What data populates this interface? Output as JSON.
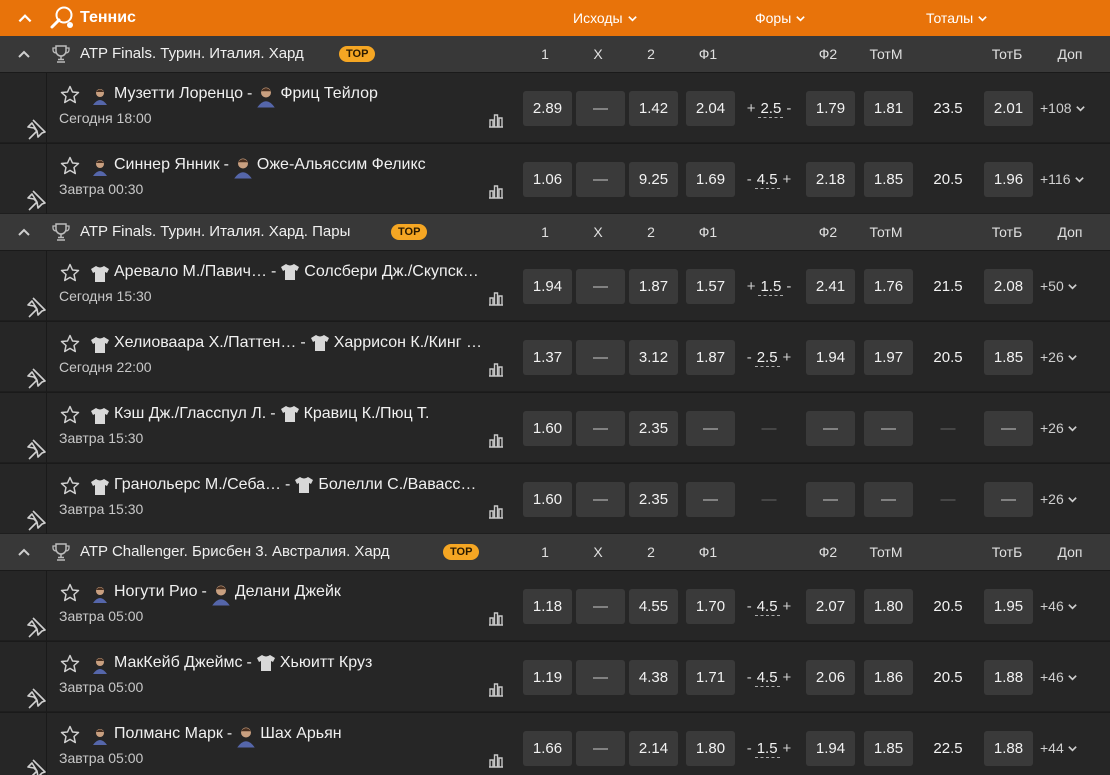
{
  "sport": {
    "title": "Теннис",
    "dropdowns": [
      "Исходы",
      "Форы",
      "Тоталы"
    ]
  },
  "columns": [
    "1",
    "X",
    "2",
    "Ф1",
    "Ф2",
    "ТотМ",
    "ТотБ",
    "Доп"
  ],
  "top_badge": "TOP",
  "leagues": [
    {
      "name": "ATP Finals. Турин. Италия. Хард",
      "matches": [
        {
          "p1": "Музетти Лоренцо",
          "p2": "Фриц Тейлор",
          "time": "Сегодня 18:00",
          "odds": {
            "w1": "2.89",
            "x": "—",
            "w2": "1.42",
            "f1": "2.04",
            "hcap": "2.5",
            "hcap_left": "+",
            "hcap_right": "-",
            "f2": "1.79",
            "totm": "1.81",
            "total": "23.5",
            "totb": "2.01"
          },
          "more": "+108"
        },
        {
          "p1": "Синнер Янник",
          "p2": "Оже-Альяссим Феликс",
          "time": "Завтра 00:30",
          "odds": {
            "w1": "1.06",
            "x": "—",
            "w2": "9.25",
            "f1": "1.69",
            "hcap": "4.5",
            "hcap_left": "-",
            "hcap_right": "+",
            "f2": "2.18",
            "totm": "1.85",
            "total": "20.5",
            "totb": "1.96"
          },
          "more": "+116"
        }
      ]
    },
    {
      "name": "ATP Finals. Турин. Италия. Хард. Пары",
      "matches": [
        {
          "p1": "Аревало М./Павич…",
          "p2": "Солсбери Дж./Скупск…",
          "time": "Сегодня 15:30",
          "odds": {
            "w1": "1.94",
            "x": "—",
            "w2": "1.87",
            "f1": "1.57",
            "hcap": "1.5",
            "hcap_left": "+",
            "hcap_right": "-",
            "f2": "2.41",
            "totm": "1.76",
            "total": "21.5",
            "totb": "2.08"
          },
          "more": "+50"
        },
        {
          "p1": "Хелиоваара Х./Паттен…",
          "p2": "Харрисон К./Кинг …",
          "time": "Сегодня 22:00",
          "odds": {
            "w1": "1.37",
            "x": "—",
            "w2": "3.12",
            "f1": "1.87",
            "hcap": "2.5",
            "hcap_left": "-",
            "hcap_right": "+",
            "f2": "1.94",
            "totm": "1.97",
            "total": "20.5",
            "totb": "1.85"
          },
          "more": "+26"
        },
        {
          "p1": "Кэш Дж./Гласспул Л.",
          "p2": "Кравиц К./Пюц Т.",
          "time": "Завтра 15:30",
          "odds": {
            "w1": "1.60",
            "x": "—",
            "w2": "2.35",
            "f1": "—",
            "hcap": "—",
            "hcap_left": "",
            "hcap_right": "",
            "f2": "—",
            "totm": "—",
            "total": "—",
            "totb": "—"
          },
          "more": "+26"
        },
        {
          "p1": "Гранольерс М./Себа…",
          "p2": "Болелли С./Вавасс…",
          "time": "Завтра 15:30",
          "odds": {
            "w1": "1.60",
            "x": "—",
            "w2": "2.35",
            "f1": "—",
            "hcap": "—",
            "hcap_left": "",
            "hcap_right": "",
            "f2": "—",
            "totm": "—",
            "total": "—",
            "totb": "—"
          },
          "more": "+26"
        }
      ]
    },
    {
      "name": "ATP Challenger. Брисбен 3. Австралия. Хард",
      "matches": [
        {
          "p1": "Ногути Рио",
          "p2": "Делани Джейк",
          "time": "Завтра 05:00",
          "odds": {
            "w1": "1.18",
            "x": "—",
            "w2": "4.55",
            "f1": "1.70",
            "hcap": "4.5",
            "hcap_left": "-",
            "hcap_right": "+",
            "f2": "2.07",
            "totm": "1.80",
            "total": "20.5",
            "totb": "1.95"
          },
          "more": "+46"
        },
        {
          "p1": "МакКейб Джеймс",
          "p2": "Хьюитт Круз",
          "time": "Завтра 05:00",
          "odds": {
            "w1": "1.19",
            "x": "—",
            "w2": "4.38",
            "f1": "1.71",
            "hcap": "4.5",
            "hcap_left": "-",
            "hcap_right": "+",
            "f2": "2.06",
            "totm": "1.86",
            "total": "20.5",
            "totb": "1.88"
          },
          "more": "+46"
        },
        {
          "p1": "Полманс Марк",
          "p2": "Шах Арьян",
          "time": "Завтра 05:00",
          "odds": {
            "w1": "1.66",
            "x": "—",
            "w2": "2.14",
            "f1": "1.80",
            "hcap": "1.5",
            "hcap_left": "-",
            "hcap_right": "+",
            "f2": "1.94",
            "totm": "1.85",
            "total": "22.5",
            "totb": "1.88"
          },
          "more": "+44"
        }
      ]
    }
  ],
  "colors": {
    "accent": "#e8730a",
    "badge": "#f5a623",
    "odd_bg": "#3a3a3a",
    "row_bg": "#262626",
    "league_bg": "#383838"
  },
  "icons": [
    "chevron-up-icon",
    "tennis-racket-icon",
    "chevron-down-icon",
    "trophy-icon",
    "pin-icon",
    "star-icon",
    "stats-icon",
    "player-avatar-icon",
    "shirt-icon"
  ]
}
